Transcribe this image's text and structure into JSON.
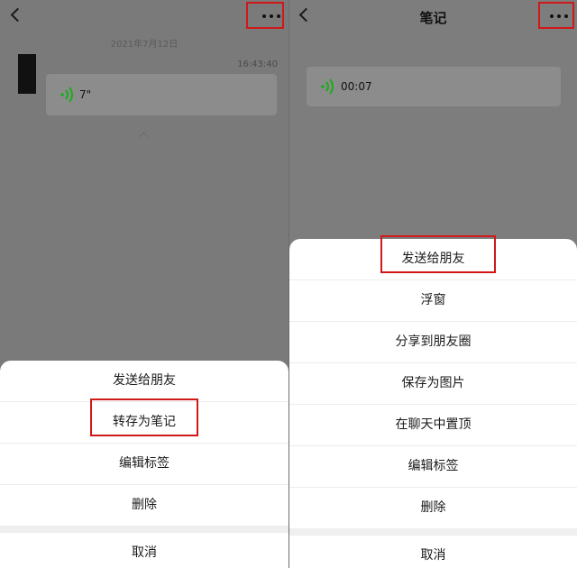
{
  "left": {
    "date": "2021年7月12日",
    "time": "16:43:40",
    "voice_duration": "7\"",
    "sheet_items": [
      "发送给朋友",
      "转存为笔记",
      "编辑标签",
      "删除"
    ],
    "highlighted_item": "转存为笔记",
    "cancel_label": "取消"
  },
  "right": {
    "title": "笔记",
    "voice_duration": "00:07",
    "sheet_items": [
      "发送给朋友",
      "浮窗",
      "分享到朋友圈",
      "保存为图片",
      "在聊天中置顶",
      "编辑标签",
      "删除"
    ],
    "highlighted_item": "发送给朋友",
    "cancel_label": "取消"
  },
  "colors": {
    "highlight": "#d01818",
    "voice_wave": "#1aad19",
    "overlay": "#7a7a7a"
  },
  "icons": {
    "back": "back-chevron-icon",
    "more": "more-dots-icon",
    "voice": "voice-wave-icon"
  }
}
